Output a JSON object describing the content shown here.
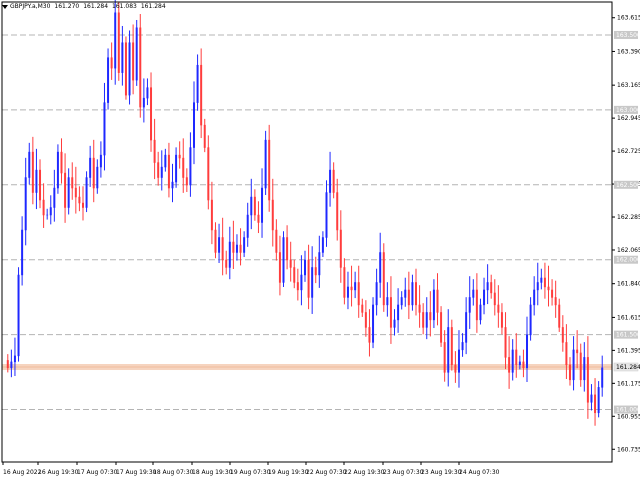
{
  "header": {
    "symbol": "GBPJPY.a,M30",
    "open": "161.270",
    "high": "161.284",
    "low": "161.083",
    "close": "161.284"
  },
  "price_axis": {
    "ticks": [
      "163.615",
      "163.390",
      "163.165",
      "162.945",
      "162.725",
      "162.505",
      "162.285",
      "162.065",
      "161.840",
      "161.615",
      "161.395",
      "161.175",
      "160.955",
      "160.735"
    ],
    "boxed_levels": [
      "163.500",
      "163.000",
      "162.500",
      "162.000",
      "161.500",
      "161.000"
    ],
    "current_price": "161.284"
  },
  "time_axis": {
    "labels": [
      "16 Aug 2022",
      "16 Aug 19:30",
      "17 Aug 07:30",
      "17 Aug 19:30",
      "18 Aug 07:30",
      "18 Aug 19:30",
      "19 Aug 07:30",
      "19 Aug 19:30",
      "22 Aug 07:30",
      "22 Aug 19:30",
      "23 Aug 07:30",
      "23 Aug 19:30",
      "24 Aug 07:30"
    ]
  },
  "colors": {
    "bull": "#1e28ff",
    "bear": "#ff3c3c",
    "grid": "#b4b4b4",
    "current_price_line": "#f5cdb4",
    "current_price_box": "#e6e6e6",
    "boxed_level_bg": "#c8c8c8"
  },
  "chart_data": {
    "type": "candlestick",
    "title": "GBPJPY.a,M30",
    "xlabel": "",
    "ylabel": "",
    "ylim": [
      160.65,
      163.72
    ],
    "grid": true,
    "horizontal_levels": [
      163.5,
      163.0,
      162.5,
      162.0,
      161.5,
      161.0
    ],
    "current_price": 161.284,
    "close_series": [
      161.28,
      161.32,
      161.36,
      161.9,
      162.2,
      162.55,
      162.72,
      162.45,
      162.6,
      162.4,
      162.3,
      162.3,
      162.35,
      162.48,
      162.72,
      162.58,
      162.35,
      162.55,
      162.48,
      162.42,
      162.38,
      162.35,
      162.55,
      162.68,
      162.48,
      162.62,
      162.7,
      163.05,
      163.35,
      163.28,
      163.65,
      163.25,
      163.45,
      163.1,
      163.45,
      163.2,
      163.55,
      163.02,
      163.08,
      163.15,
      162.8,
      162.65,
      162.55,
      162.62,
      162.7,
      162.48,
      162.52,
      162.7,
      162.68,
      162.55,
      162.5,
      162.75,
      163.05,
      163.3,
      162.9,
      162.75,
      162.4,
      162.2,
      162.05,
      162.15,
      162.0,
      161.95,
      162.12,
      162.05,
      162.1,
      162.05,
      162.15,
      162.3,
      162.42,
      162.3,
      162.25,
      162.48,
      162.8,
      162.4,
      162.2,
      162.05,
      161.85,
      162.15,
      162.0,
      161.95,
      161.85,
      161.8,
      161.9,
      162.0,
      161.75,
      161.95,
      161.9,
      162.05,
      162.15,
      162.45,
      162.6,
      162.45,
      162.2,
      161.95,
      161.75,
      161.82,
      161.8,
      161.85,
      161.7,
      161.65,
      161.55,
      161.45,
      161.7,
      161.85,
      162.05,
      161.7,
      161.75,
      161.55,
      161.6,
      161.7,
      161.75,
      161.8,
      161.7,
      161.85,
      161.7,
      161.65,
      161.55,
      161.65,
      161.6,
      161.8,
      161.65,
      161.45,
      161.25,
      161.55,
      161.3,
      161.25,
      161.4,
      161.45,
      161.65,
      161.75,
      161.8,
      161.6,
      161.7,
      161.8,
      161.85,
      161.78,
      161.7,
      161.65,
      161.55,
      161.35,
      161.25,
      161.4,
      161.3,
      161.32,
      161.28,
      161.5,
      161.7,
      161.8,
      161.85,
      161.88,
      161.82,
      161.8,
      161.75,
      161.7,
      161.55,
      161.45,
      161.3,
      161.2,
      161.4,
      161.38,
      161.2,
      161.35,
      161.05,
      161.1,
      160.98,
      161.15,
      161.28
    ]
  }
}
